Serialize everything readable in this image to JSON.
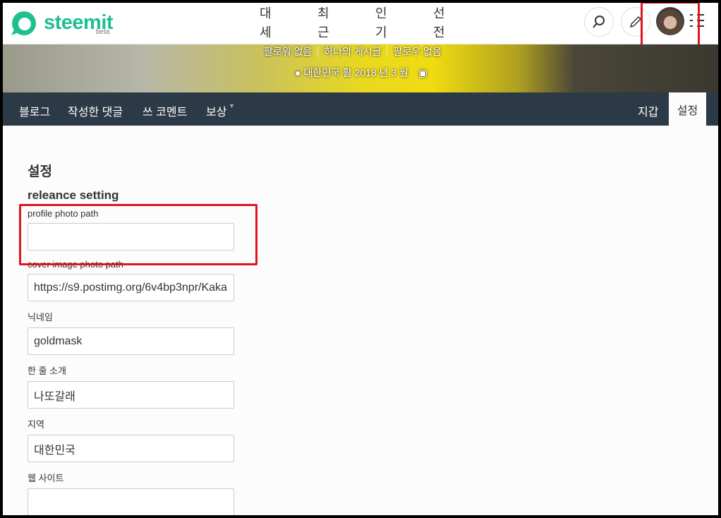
{
  "header": {
    "logo": "steemit",
    "beta": "beta",
    "nav": [
      "대세글",
      "최근글",
      "인기글",
      "선전"
    ]
  },
  "cover": {
    "stats": [
      "팔로워 없음",
      "하나의 게시글",
      "팔로우 없음"
    ],
    "location": "대한민국 활 2018 년 3 월"
  },
  "subnav": {
    "items": [
      "블로그",
      "작성한 댓글",
      "쓰 코멘트",
      "보상"
    ],
    "wallet": "지갑",
    "settings": "설정"
  },
  "settings": {
    "title": "설정",
    "subtitle": "releance setting",
    "fields": [
      {
        "label": "profile photo path",
        "value": ""
      },
      {
        "label": "cover image photo path",
        "value": "https://s9.postimg.org/6v4bp3npr/Kaka"
      },
      {
        "label": "닉네임",
        "value": "goldmask"
      },
      {
        "label": "한 줄 소개",
        "value": "나또갈래"
      },
      {
        "label": "지역",
        "value": "대한민국"
      },
      {
        "label": "웹 사이트",
        "value": ""
      }
    ]
  },
  "colors": {
    "brand": "#1fbf8f",
    "nav_bg": "#2b3a46",
    "highlight": "#e0141e"
  }
}
